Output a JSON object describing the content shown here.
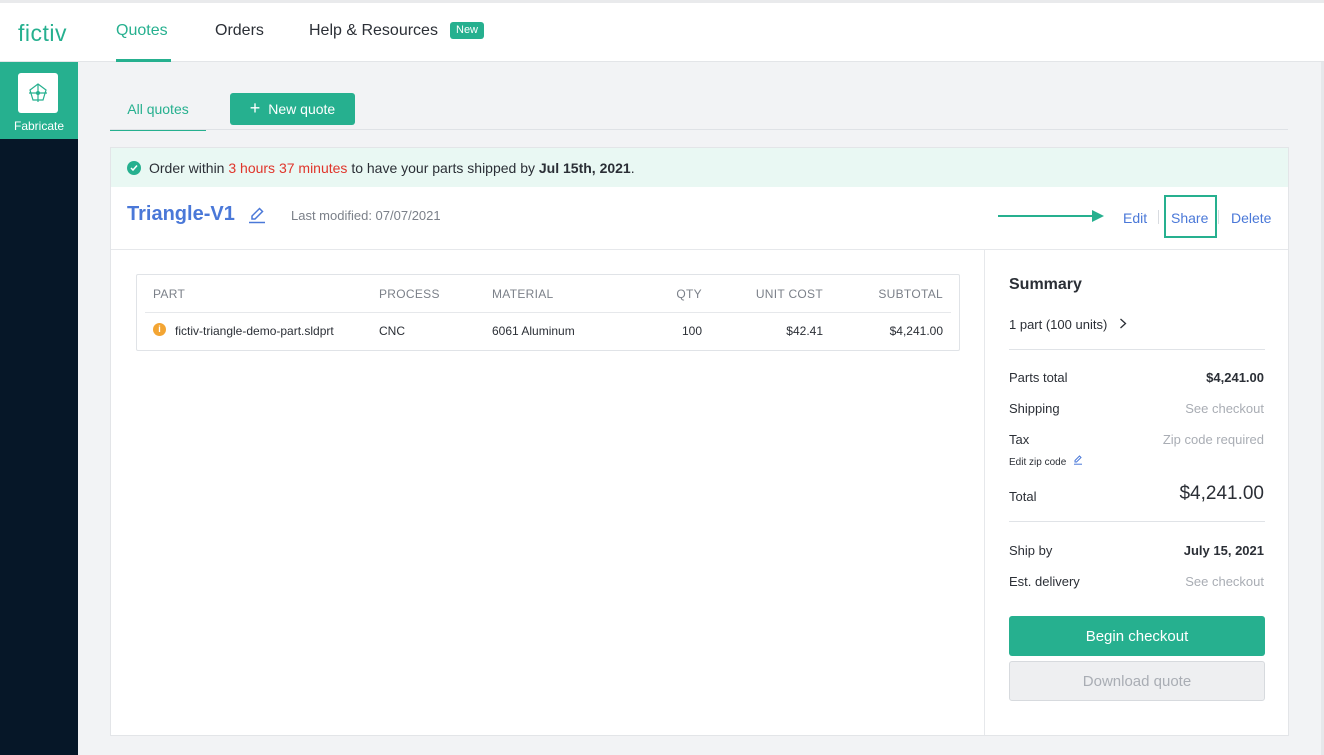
{
  "brand": {
    "logo": "fictiv"
  },
  "nav": {
    "items": [
      {
        "label": "Quotes",
        "active": true
      },
      {
        "label": "Orders",
        "active": false
      },
      {
        "label": "Help & Resources",
        "active": false
      }
    ],
    "new_badge": "New"
  },
  "sidebar": {
    "items": [
      {
        "label": "Fabricate",
        "icon": "fabricate-icon",
        "active": true
      }
    ]
  },
  "tabs": {
    "all_quotes": "All quotes",
    "new_quote": "New quote"
  },
  "banner": {
    "prefix": "Order within",
    "time": "3 hours 37 minutes",
    "middle": "to have your parts shipped by",
    "date": "Jul 15th, 2021",
    "suffix": "."
  },
  "quote": {
    "name": "Triangle-V1",
    "last_modified": "Last modified: 07/07/2021",
    "actions": {
      "edit": "Edit",
      "share": "Share",
      "delete": "Delete"
    }
  },
  "parts_table": {
    "headers": {
      "part": "PART",
      "process": "PROCESS",
      "material": "MATERIAL",
      "qty": "QTY",
      "unit_cost": "UNIT COST",
      "subtotal": "SUBTOTAL"
    },
    "rows": [
      {
        "part": "fictiv-triangle-demo-part.sldprt",
        "process": "CNC",
        "material": "6061 Aluminum",
        "qty": "100",
        "unit_cost": "$42.41",
        "subtotal": "$4,241.00"
      }
    ]
  },
  "summary": {
    "title": "Summary",
    "parts_count": "1 part (100 units)",
    "parts_total_label": "Parts total",
    "parts_total_value": "$4,241.00",
    "shipping_label": "Shipping",
    "shipping_value": "See checkout",
    "tax_label": "Tax",
    "tax_value": "Zip code required",
    "edit_zip": "Edit zip code",
    "total_label": "Total",
    "total_value": "$4,241.00",
    "ship_by_label": "Ship by",
    "ship_by_value": "July 15, 2021",
    "est_delivery_label": "Est. delivery",
    "est_delivery_value": "See checkout",
    "begin_checkout": "Begin checkout",
    "download_quote": "Download quote"
  },
  "colors": {
    "accent": "#26b08f",
    "link": "#4a78d8",
    "alert": "#e0352b",
    "sidebar": "#061728",
    "warning": "#f3a533"
  }
}
